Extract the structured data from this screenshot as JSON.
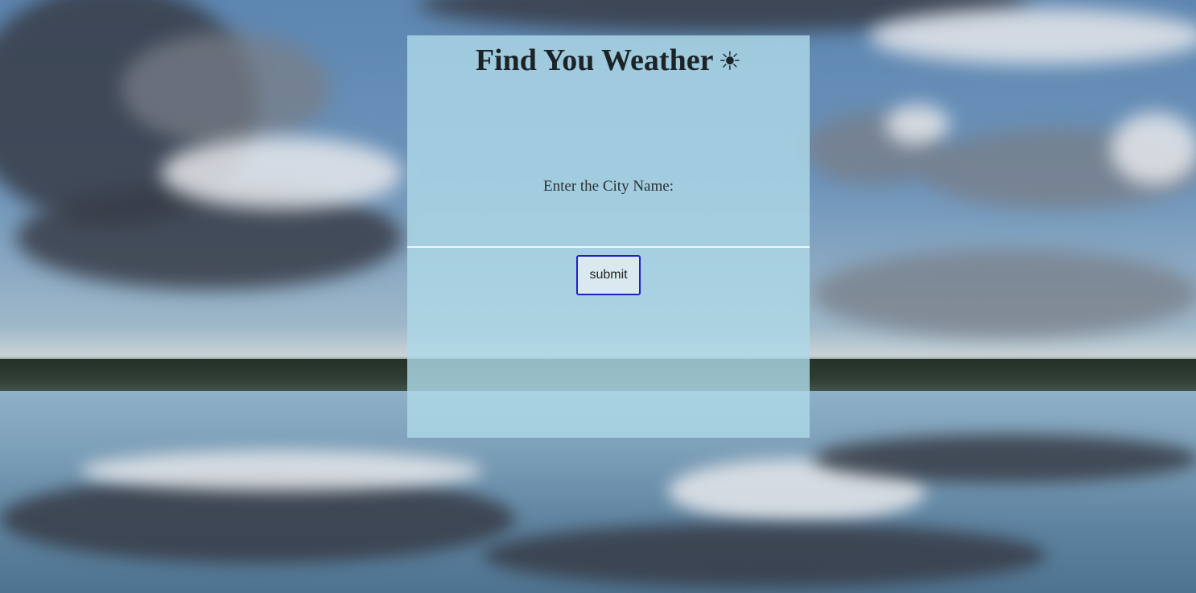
{
  "header": {
    "title": "Find You Weather",
    "title_icon": "sun-icon",
    "title_icon_glyph": "☀"
  },
  "form": {
    "city_label": "Enter the City Name:",
    "city_input_value": "",
    "city_input_placeholder": "",
    "submit_label": "submit"
  },
  "colors": {
    "panel_background": "#add8e6",
    "button_border": "#2020c8",
    "title_text": "#1c2326"
  }
}
